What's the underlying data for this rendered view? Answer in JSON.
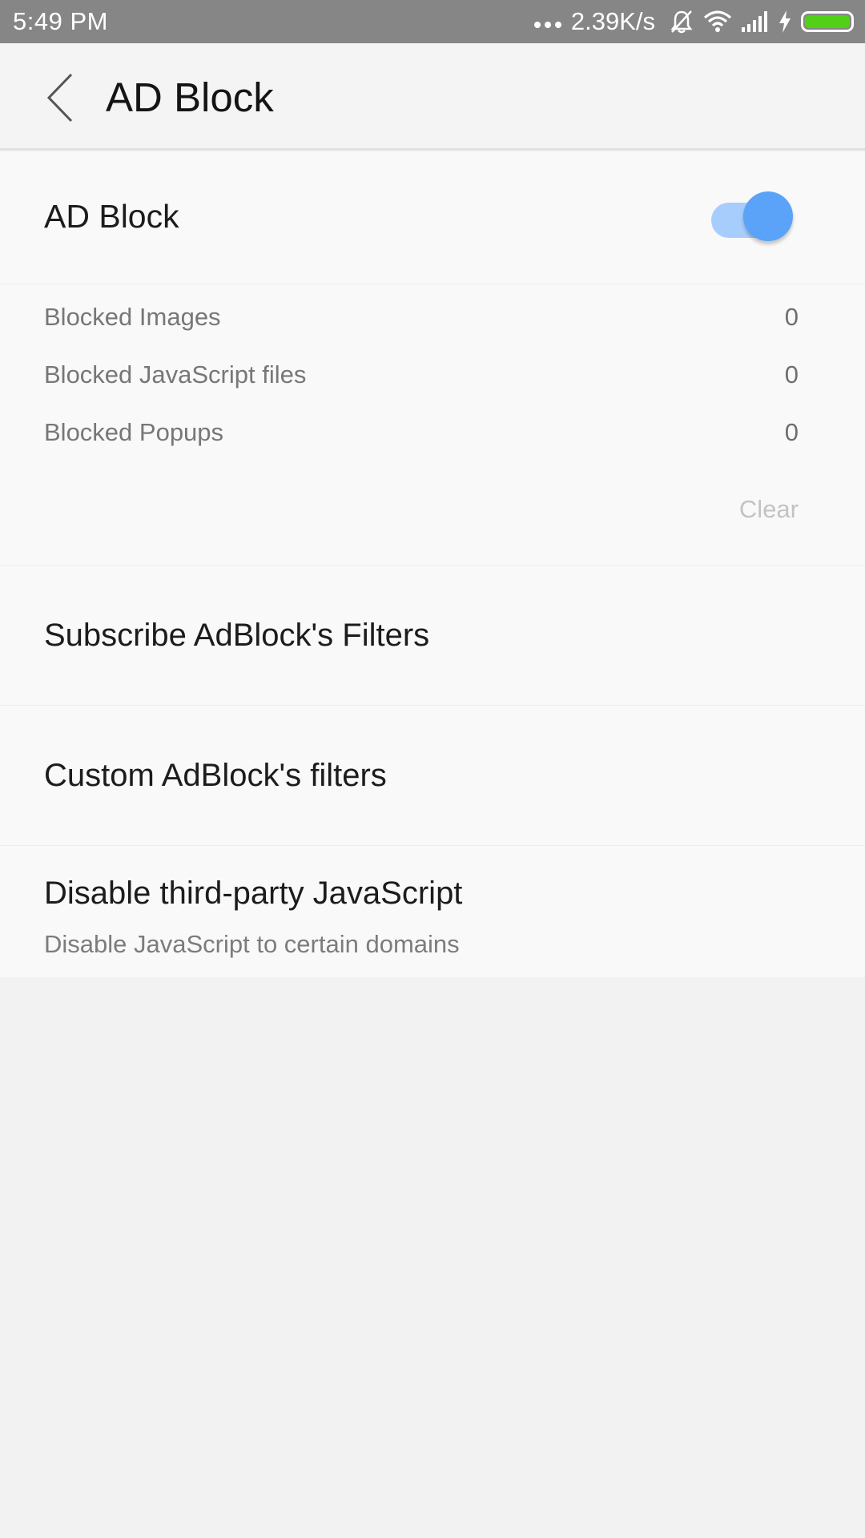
{
  "status_bar": {
    "time": "5:49 PM",
    "net_speed": "2.39K/s",
    "icons": [
      "more-dots-icon",
      "bell-muted-icon",
      "wifi-icon",
      "signal-icon",
      "charging-bolt-icon",
      "battery-icon"
    ],
    "battery_color": "#52d017"
  },
  "header": {
    "back_icon": "chevron-left-icon",
    "title": "AD Block"
  },
  "ad_block_toggle": {
    "label": "AD Block",
    "enabled": true,
    "accent_color": "#5aa3f8"
  },
  "stats": {
    "rows": [
      {
        "label": "Blocked Images",
        "value": "0"
      },
      {
        "label": "Blocked JavaScript files",
        "value": "0"
      },
      {
        "label": "Blocked Popups",
        "value": "0"
      }
    ],
    "clear_label": "Clear"
  },
  "menu": {
    "subscribe": {
      "title": "Subscribe AdBlock's Filters"
    },
    "custom": {
      "title": "Custom AdBlock's filters"
    },
    "disable_js": {
      "title": "Disable third-party JavaScript",
      "subtitle": "Disable JavaScript to certain domains"
    }
  }
}
